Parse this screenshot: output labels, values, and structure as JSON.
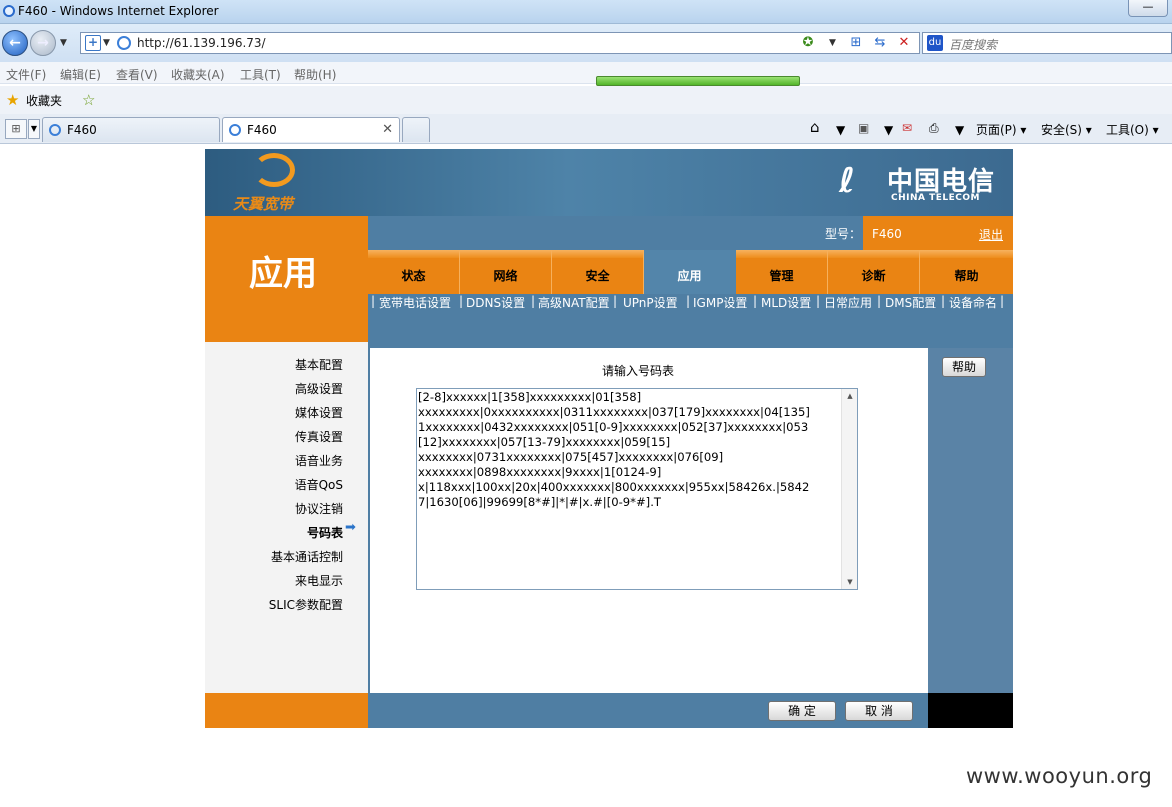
{
  "browser": {
    "window_title": "F460 - Windows Internet Explorer",
    "url": "http://61.139.196.73/",
    "search_placeholder": "百度搜索",
    "menu": [
      "文件(F)",
      "编辑(E)",
      "查看(V)",
      "收藏夹(A)",
      "工具(T)",
      "帮助(H)"
    ],
    "favorites_label": "收藏夹",
    "tabs": [
      {
        "title": "F460"
      },
      {
        "title": "F460",
        "active": true
      }
    ],
    "command_bar": {
      "page": "页面(P)",
      "safety": "安全(S)",
      "tools": "工具(O)"
    }
  },
  "router": {
    "brand_left": "天翼宽带",
    "brand_right_cn": "中国电信",
    "brand_right_en": "CHINA TELECOM",
    "page_title": "应用",
    "model_label": "型号：",
    "model_value": "F460",
    "logout": "退出",
    "main_tabs": [
      "状态",
      "网络",
      "安全",
      "应用",
      "管理",
      "诊断",
      "帮助"
    ],
    "active_tab": "应用",
    "sub_nav": [
      "宽带电话设置",
      "DDNS设置",
      "高级NAT配置",
      "UPnP设置",
      "IGMP设置",
      "MLD设置",
      "日常应用",
      "DMS配置",
      "设备命名"
    ],
    "left_menu": [
      "基本配置",
      "高级设置",
      "媒体设置",
      "传真设置",
      "语音业务",
      "语音QoS",
      "协议注销",
      "号码表",
      "基本通话控制",
      "来电显示",
      "SLIC参数配置"
    ],
    "left_menu_selected": "号码表",
    "content_heading": "请输入号码表",
    "dial_table": "[2-8]xxxxxx|1[358]xxxxxxxxx|01[358]\nxxxxxxxxx|0xxxxxxxxxx|0311xxxxxxxx|037[179]xxxxxxxx|04[135]\n1xxxxxxxx|0432xxxxxxxx|051[0-9]xxxxxxxx|052[37]xxxxxxxx|053\n[12]xxxxxxxx|057[13-79]xxxxxxxx|059[15]\nxxxxxxxx|0731xxxxxxxx|075[457]xxxxxxxx|076[09]\nxxxxxxxx|0898xxxxxxxx|9xxxx|1[0124-9]\nx|118xxx|100xx|20x|400xxxxxxx|800xxxxxxx|955xx|58426x.|5842\n7|1630[06]|99699[8*#]|*|#|x.#|[0-9*#].T",
    "help_button": "帮助",
    "ok_button": "确 定",
    "cancel_button": "取 消"
  },
  "watermark": "www.wooyun.org",
  "colors": {
    "orange": "#ea8413",
    "steel_blue": "#4f7ea3",
    "active_tab": "#5385aa"
  }
}
